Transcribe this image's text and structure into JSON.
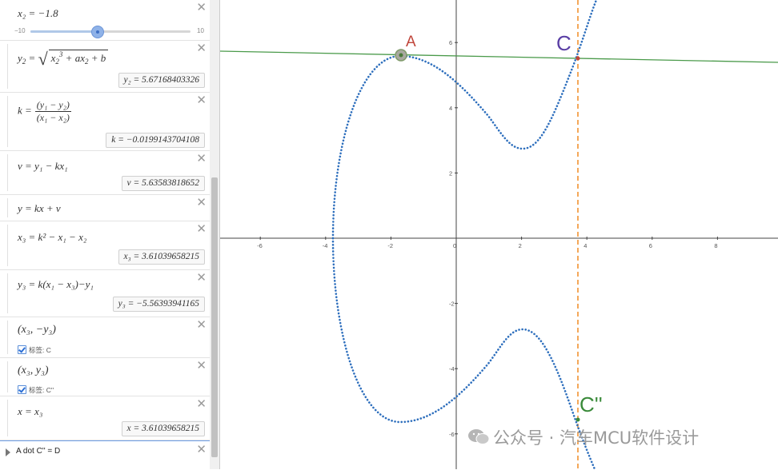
{
  "algebra": {
    "slider": {
      "expr": "x₂ = −1.8",
      "min": "−10",
      "max": "10",
      "value": -1.8
    },
    "y2": {
      "lhs": "y",
      "lhs_sub": "2",
      "value": "y₂ = 5.67168403326"
    },
    "k": {
      "num": "(y₁ − y₂)",
      "den": "(x₁ − x₂)",
      "lhs": "k =",
      "value": "k = −0.0199143704108"
    },
    "v": {
      "expr": "v = y₁ − kx₁",
      "value": "v = 5.63583818652"
    },
    "line": {
      "expr": "y = kx + v"
    },
    "x3": {
      "expr": "x₃ = k² − x₁ − x₂",
      "value": "x₃ = 3.61039658215"
    },
    "y3": {
      "expr": "y₃ = k(x₁ − x₃)−y₁",
      "value": "y₃ = −5.56393941165"
    },
    "pointC": {
      "expr": "(x₃, −y₃)",
      "label_prefix": "标签:",
      "label": "C"
    },
    "pointC2": {
      "expr": "(x₃, y₃)",
      "label_prefix": "标签:",
      "label": "C''"
    },
    "vline": {
      "expr": "x = x₃",
      "value": "x = 3.61039658215"
    },
    "command": "A dot C'' = D"
  },
  "graph": {
    "labels": {
      "A": "A",
      "C": "C",
      "C2": "C''"
    },
    "xticks": [
      "-6",
      "-4",
      "-2",
      "0",
      "2",
      "4",
      "6",
      "8"
    ],
    "yticks": [
      "6",
      "4",
      "2",
      "-2",
      "-4",
      "-6"
    ],
    "colors": {
      "curve": "#2e6fbd",
      "line": "#4a9a4a",
      "vline": "#f08c24",
      "A": "#c0453a",
      "C": "#5a3fa5",
      "C2": "#3a8a3a"
    }
  },
  "watermark": "公众号 · 汽车MCU软件设计"
}
